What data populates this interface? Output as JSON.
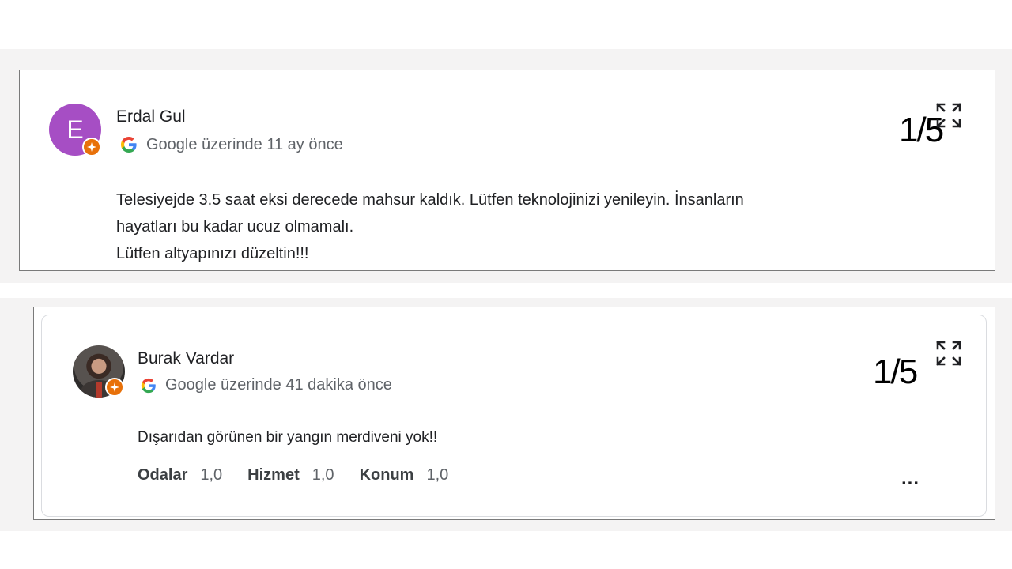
{
  "reviews": [
    {
      "author": "Erdal Gul",
      "avatar_letter": "E",
      "source": "Google üzerinde 11 ay önce",
      "rating_display": "1/5",
      "text_lines": [
        "Telesiyejde 3.5 saat eksi derecede mahsur kaldık. Lütfen teknolojinizi yenileyin. İnsanların",
        "hayatları bu kadar ucuz olmamalı.",
        "Lütfen altyapınızı düzeltin!!!"
      ]
    },
    {
      "author": "Burak Vardar",
      "source": "Google üzerinde 41 dakika önce",
      "rating_display": "1/5",
      "text": "Dışarıdan görünen bir yangın merdiveni yok!!",
      "aspects": [
        {
          "label": "Odalar",
          "value": "1,0"
        },
        {
          "label": "Hizmet",
          "value": "1,0"
        },
        {
          "label": "Konum",
          "value": "1,0"
        }
      ],
      "more_label": "..."
    }
  ],
  "colors": {
    "avatar_letter_bg": "#a64ec4",
    "local_guide_badge": "#e8710a",
    "google_blue": "#4285F4",
    "google_red": "#EA4335",
    "google_yellow": "#FBBC05",
    "google_green": "#34A853"
  },
  "icons": {
    "local_guide": "local-guide-badge-icon",
    "google": "google-g-icon",
    "expand": "expand-icon",
    "more": "more-horizontal-icon"
  }
}
